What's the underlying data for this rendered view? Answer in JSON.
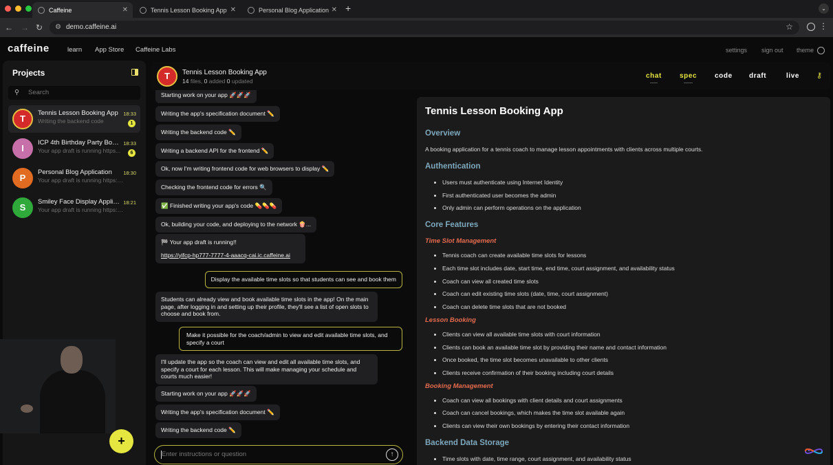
{
  "browser": {
    "tabs": [
      {
        "label": "Caffeine"
      },
      {
        "label": "Tennis Lesson Booking App"
      },
      {
        "label": "Personal Blog Application"
      }
    ],
    "url": "demo.caffeine.ai"
  },
  "appbar": {
    "logo": "caffeine",
    "nav": [
      "learn",
      "App Store",
      "Caffeine Labs"
    ],
    "right": [
      "settings",
      "sign out",
      "theme"
    ]
  },
  "sidebar": {
    "title": "Projects",
    "search_placeholder": "Search",
    "projects": [
      {
        "initial": "T",
        "name": "Tennis Lesson Booking App",
        "subtitle": "Writing the backend code",
        "time": "18:33",
        "badge": "1",
        "color": "#d42a2a"
      },
      {
        "initial": "I",
        "name": "ICP 4th Birthday Party Boo...",
        "subtitle": "Your app draft is running https...",
        "time": "18:33",
        "badge": "6",
        "color": "#c76fa8"
      },
      {
        "initial": "P",
        "name": "Personal Blog Application",
        "subtitle": "Your app draft is running https://...",
        "time": "18:30",
        "badge": "",
        "color": "#e26b22"
      },
      {
        "initial": "S",
        "name": "Smiley Face Display Applic...",
        "subtitle": "Your app draft is running https://s4...",
        "time": "18:21",
        "badge": "",
        "color": "#2faa3a"
      }
    ],
    "add_label": "+"
  },
  "header": {
    "initial": "T",
    "title": "Tennis Lesson Booking App",
    "files": "14",
    "files_label": " files, ",
    "added": "0",
    "added_label": " added ",
    "updated": "0",
    "updated_label": " updated",
    "tabs": [
      "chat",
      "spec",
      "code",
      "draft",
      "live"
    ]
  },
  "chat": {
    "messages": [
      {
        "text": "Starting work on your app 🚀🚀🚀"
      },
      {
        "text": "Writing the app's specification document ✏️"
      },
      {
        "text": "Writing the backend code ✏️"
      },
      {
        "text": "Writing a backend API for the frontend ✏️"
      },
      {
        "text": "Ok, now I'm writing frontend code for web browsers to display ✏️"
      },
      {
        "text": "Checking the frontend code for errors 🔍"
      },
      {
        "text": "✅ Finished writing your app's code 💊💊💊"
      },
      {
        "text": "Ok, building your code, and deploying to the network 🍿..."
      },
      {
        "text": "🏁 Your app draft is running!!",
        "link": "https://yifcp-hp777-7777-4-aaacq-cai.ic.caffeine.ai"
      },
      {
        "text": "Display the available time slots so that students can see and book them",
        "user": true
      },
      {
        "text": "Students can already view and book available time slots in the app! On the main page, after logging in and setting up their profile, they'll see a list of open slots to choose and book from."
      },
      {
        "text": "Make it possible for the coach/admin to view and edit available time slots, and specify a court",
        "user": true
      },
      {
        "text": "I'll update the app so the coach can view and edit all available time slots, and specify a court for each lesson. This will make managing your schedule and courts much easier!"
      },
      {
        "text": "Starting work on your app 🚀🚀🚀"
      },
      {
        "text": "Writing the app's specification document ✏️"
      },
      {
        "text": "Writing the backend code ✏️"
      }
    ],
    "input_placeholder": "Enter instructions or question"
  },
  "spec": {
    "title": "Tennis Lesson Booking App",
    "overview_heading": "Overview",
    "overview_text": "A booking application for a tennis coach to manage lesson appointments with clients across multiple courts.",
    "auth_heading": "Authentication",
    "auth_items": [
      "Users must authenticate using Internet Identity",
      "First authenticated user becomes the admin",
      "Only admin can perform operations on the application"
    ],
    "core_heading": "Core Features",
    "timeslot_heading": "Time Slot Management",
    "timeslot_items": [
      "Tennis coach can create available time slots for lessons",
      "Each time slot includes date, start time, end time, court assignment, and availability status",
      "Coach can view all created time slots",
      "Coach can edit existing time slots (date, time, court assignment)",
      "Coach can delete time slots that are not booked"
    ],
    "lesson_heading": "Lesson Booking",
    "lesson_items": [
      "Clients can view all available time slots with court information",
      "Clients can book an available time slot by providing their name and contact information",
      "Once booked, the time slot becomes unavailable to other clients",
      "Clients receive confirmation of their booking including court details"
    ],
    "booking_heading": "Booking Management",
    "booking_items": [
      "Coach can view all bookings with client details and court assignments",
      "Coach can cancel bookings, which makes the time slot available again",
      "Clients can view their own bookings by entering their contact information"
    ],
    "storage_heading": "Backend Data Storage",
    "storage_items": [
      "Time slots with date, time range, court assignment, and availability status"
    ]
  }
}
